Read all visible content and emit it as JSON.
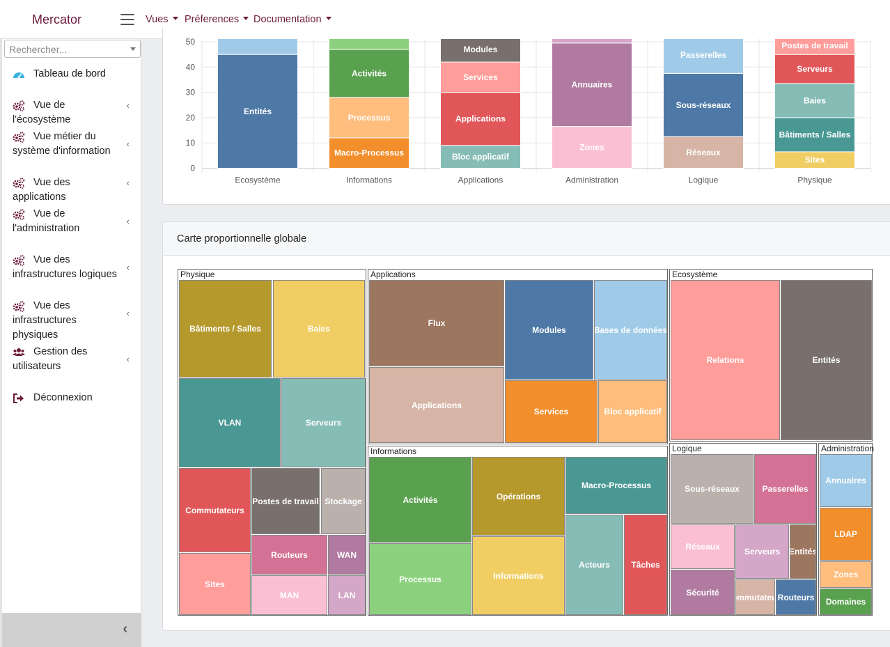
{
  "app": {
    "brand": "Mercator"
  },
  "nav": {
    "vues": "Vues",
    "preferences": "Préferences",
    "documentation": "Documentation"
  },
  "sidebar": {
    "search_placeholder": "Rechercher...",
    "items": [
      {
        "label": "Tableau de bord",
        "icon": "dashboard-icon"
      },
      {
        "label": "Vue de l'écosystème",
        "icon": "cogs-icon"
      },
      {
        "label": "Vue métier du système d'information",
        "icon": "cogs-icon"
      },
      {
        "label": "Vue des applications",
        "icon": "cogs-icon"
      },
      {
        "label": "Vue de l'administration",
        "icon": "cogs-icon"
      },
      {
        "label": "Vue des infrastructures logiques",
        "icon": "cogs-icon"
      },
      {
        "label": "Vue des infrastructures physiques",
        "icon": "cogs-icon"
      },
      {
        "label": "Gestion des utilisateurs",
        "icon": "users-icon"
      },
      {
        "label": "Déconnexion",
        "icon": "sign-out-icon"
      }
    ]
  },
  "treemap_card": {
    "title": "Carte proportionnelle globale"
  },
  "chart_data": [
    {
      "type": "bar",
      "stacked": true,
      "categories": [
        "Ecosystème",
        "Informations",
        "Applications",
        "Administration",
        "Logique",
        "Physique"
      ],
      "y_ticks": [
        0,
        10,
        20,
        30,
        40,
        50
      ],
      "ylim": [
        0,
        52
      ],
      "grid": true,
      "stacks": [
        {
          "category": "Ecosystème",
          "segments": [
            {
              "label": "Entités",
              "value": 45,
              "color": "#4e79a7"
            },
            {
              "label": "",
              "value": 7,
              "color": "#a0cbe8"
            }
          ]
        },
        {
          "category": "Informations",
          "segments": [
            {
              "label": "Macro-Processus",
              "value": 12,
              "color": "#f28e2b"
            },
            {
              "label": "Processus",
              "value": 16,
              "color": "#ffbe7d"
            },
            {
              "label": "Activités",
              "value": 19,
              "color": "#59a14f"
            },
            {
              "label": "",
              "value": 5,
              "color": "#8cd17d"
            }
          ]
        },
        {
          "category": "Applications",
          "segments": [
            {
              "label": "Bloc applicatif",
              "value": 9,
              "color": "#86bcb6"
            },
            {
              "label": "Applications",
              "value": 21,
              "color": "#e15759"
            },
            {
              "label": "Services",
              "value": 12,
              "color": "#ff9d9a"
            },
            {
              "label": "Modules",
              "value": 10,
              "color": "#79706e"
            }
          ]
        },
        {
          "category": "Administration",
          "segments": [
            {
              "label": "Zones",
              "value": 16.5,
              "color": "#fabfd2"
            },
            {
              "label": "Annuaires",
              "value": 33,
              "color": "#b07aa1"
            },
            {
              "label": "",
              "value": 2.5,
              "color": "#d4a6c8"
            }
          ]
        },
        {
          "category": "Logique",
          "segments": [
            {
              "label": "Réseaux",
              "value": 12.5,
              "color": "#d7b5a6"
            },
            {
              "label": "Sous-réseaux",
              "value": 25,
              "color": "#4e79a7"
            },
            {
              "label": "Passerelles",
              "value": 14.5,
              "color": "#a0cbe8"
            }
          ]
        },
        {
          "category": "Physique",
          "segments": [
            {
              "label": "Sites",
              "value": 6.5,
              "color": "#f1ce63"
            },
            {
              "label": "Bâtiments / Salles",
              "value": 13.5,
              "color": "#499894"
            },
            {
              "label": "Baies",
              "value": 13.5,
              "color": "#86bcb6"
            },
            {
              "label": "Serveurs",
              "value": 11.5,
              "color": "#e15759"
            },
            {
              "label": "Postes de travail",
              "value": 7,
              "color": "#ff9d9a"
            }
          ]
        }
      ]
    },
    {
      "type": "treemap",
      "groups": [
        {
          "name": "Physique",
          "cells": [
            {
              "label": "Bâtiments / Salles",
              "color": "#b6992d"
            },
            {
              "label": "Baies",
              "color": "#f1ce63"
            },
            {
              "label": "VLAN",
              "color": "#499894"
            },
            {
              "label": "Serveurs",
              "color": "#86bcb6"
            },
            {
              "label": "Commutateurs",
              "color": "#e15759"
            },
            {
              "label": "Postes de travail",
              "color": "#79706e"
            },
            {
              "label": "Stockage",
              "color": "#bab0ac"
            },
            {
              "label": "Routeurs",
              "color": "#d37295"
            },
            {
              "label": "WAN",
              "color": "#b07aa1"
            },
            {
              "label": "Sites",
              "color": "#ff9d9a"
            },
            {
              "label": "MAN",
              "color": "#fabfd2"
            },
            {
              "label": "LAN",
              "color": "#d4a6c8"
            }
          ]
        },
        {
          "name": "Applications",
          "cells": [
            {
              "label": "Flux",
              "color": "#9d7660"
            },
            {
              "label": "Modules",
              "color": "#4e79a7"
            },
            {
              "label": "Bases de données",
              "color": "#a0cbe8"
            },
            {
              "label": "Applications",
              "color": "#d7b5a6"
            },
            {
              "label": "Services",
              "color": "#f28e2b"
            },
            {
              "label": "Bloc applicatif",
              "color": "#ffbe7d"
            }
          ]
        },
        {
          "name": "Ecosystème",
          "cells": [
            {
              "label": "Relations",
              "color": "#ff9d9a"
            },
            {
              "label": "Entités",
              "color": "#79706e"
            }
          ]
        },
        {
          "name": "Informations",
          "cells": [
            {
              "label": "Activités",
              "color": "#59a14f"
            },
            {
              "label": "Opérations",
              "color": "#b6992d"
            },
            {
              "label": "Macro-Processus",
              "color": "#499894"
            },
            {
              "label": "Processus",
              "color": "#8cd17d"
            },
            {
              "label": "Informations",
              "color": "#f1ce63"
            },
            {
              "label": "Acteurs",
              "color": "#86bcb6"
            },
            {
              "label": "Tâches",
              "color": "#e15759"
            }
          ]
        },
        {
          "name": "Logique",
          "cells": [
            {
              "label": "Sous-réseaux",
              "color": "#bab0ac"
            },
            {
              "label": "Passerelles",
              "color": "#d37295"
            },
            {
              "label": "Réseaux",
              "color": "#fabfd2"
            },
            {
              "label": "Serveurs",
              "color": "#d4a6c8"
            },
            {
              "label": "Entités",
              "color": "#9d7660"
            },
            {
              "label": "Sécurité",
              "color": "#b07aa1"
            },
            {
              "label": "Commutateurs",
              "color": "#d7b5a6"
            },
            {
              "label": "Routeurs",
              "color": "#4e79a7"
            }
          ]
        },
        {
          "name": "Administration",
          "cells": [
            {
              "label": "Annuaires",
              "color": "#a0cbe8"
            },
            {
              "label": "LDAP",
              "color": "#f28e2b"
            },
            {
              "label": "Zones",
              "color": "#ffbe7d"
            },
            {
              "label": "Domaines",
              "color": "#59a14f"
            }
          ]
        }
      ]
    }
  ]
}
